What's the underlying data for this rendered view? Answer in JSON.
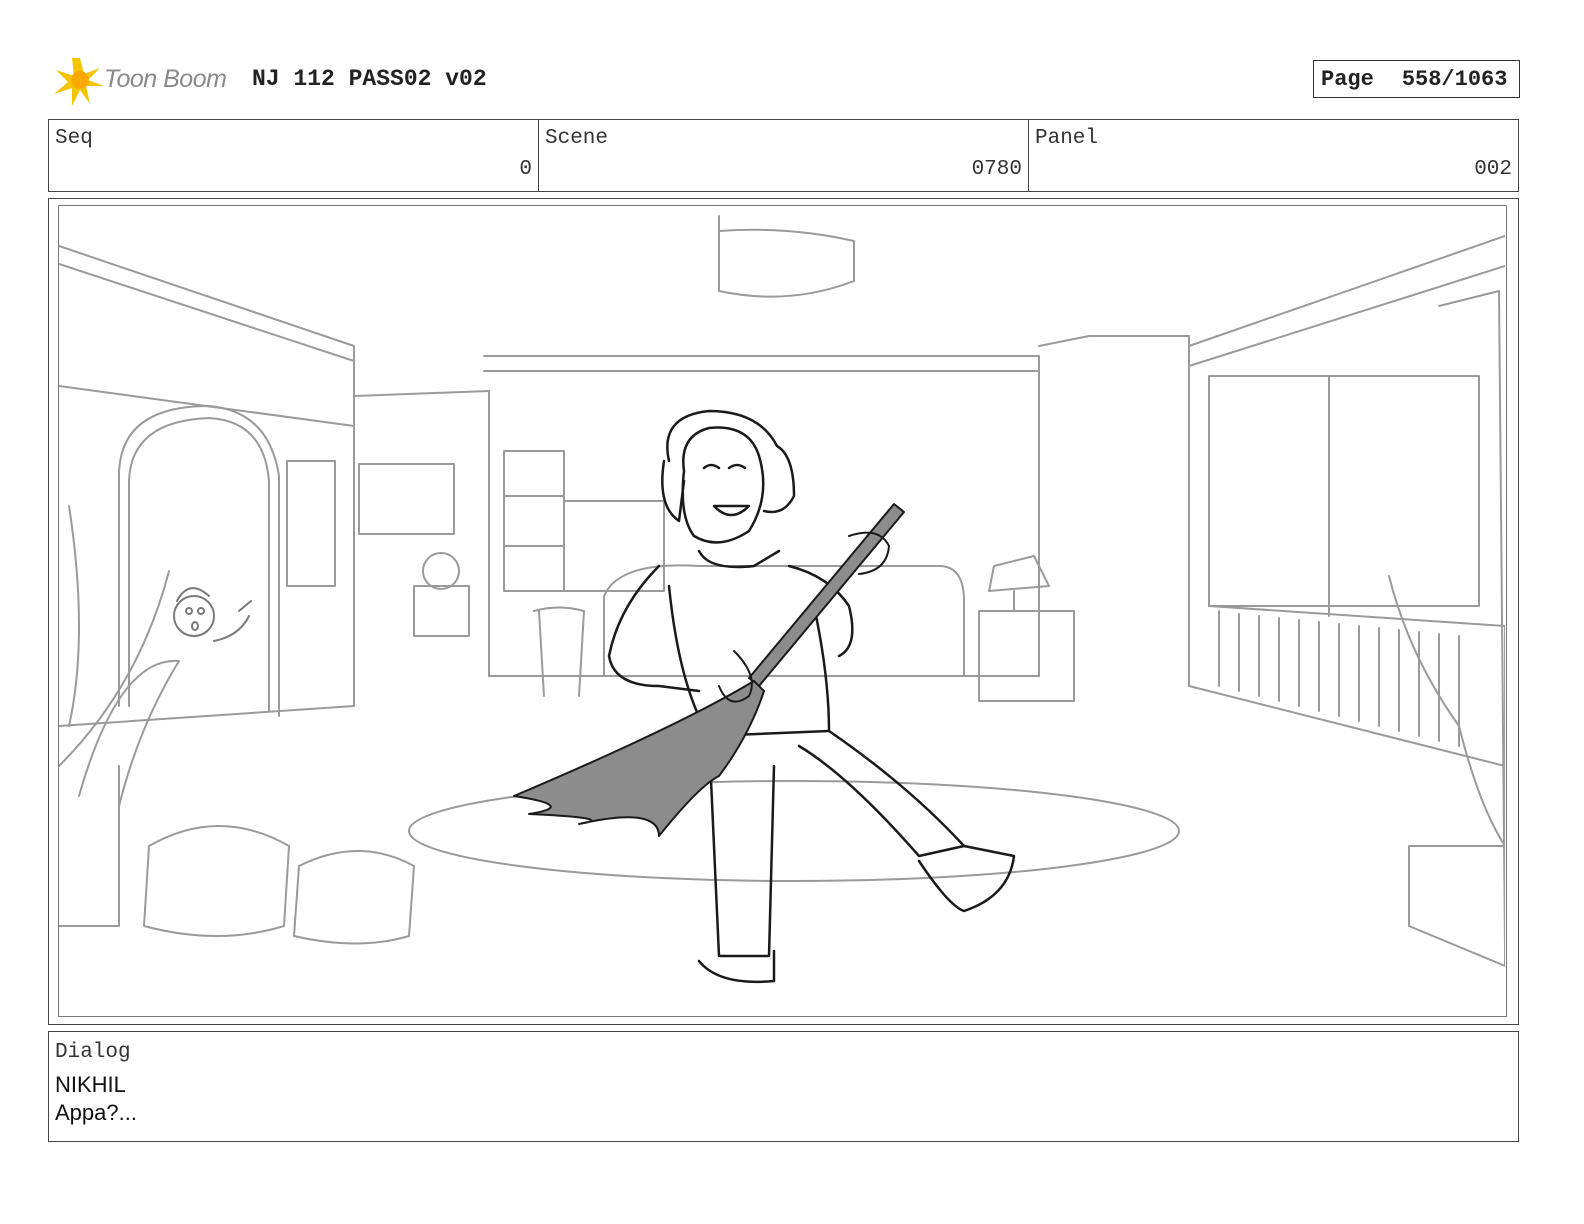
{
  "header": {
    "logo_text": "Toon Boom",
    "title": "NJ 112 PASS02 v02",
    "page_label": "Page",
    "page_value": "558/1063"
  },
  "info": {
    "seq_label": "Seq",
    "seq_value": "0",
    "scene_label": "Scene",
    "scene_value": "0780",
    "panel_label": "Panel",
    "panel_value": "002"
  },
  "dialog": {
    "label": "Dialog",
    "speaker": "NIKHIL",
    "line": "Appa?..."
  },
  "colors": {
    "logo_star": "#f5c400",
    "sketch_light": "#9a9a9a",
    "sketch_dark": "#1a1a1a",
    "broom_fill": "#8c8c8c"
  }
}
